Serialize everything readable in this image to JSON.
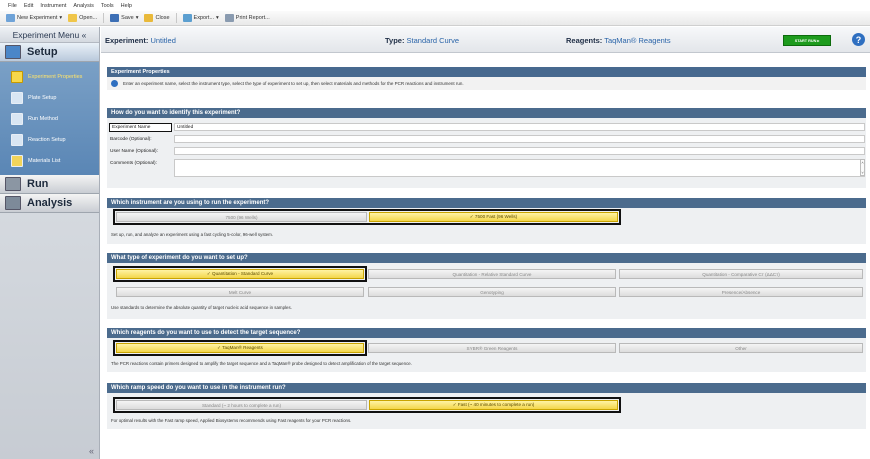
{
  "menubar": [
    "File",
    "Edit",
    "Instrument",
    "Analysis",
    "Tools",
    "Help"
  ],
  "toolbar": {
    "new_experiment": "New Experiment",
    "open": "Open...",
    "save": "Save",
    "close": "Close",
    "export": "Export...",
    "print_report": "Print Report..."
  },
  "sidebar": {
    "title": "Experiment Menu «",
    "setup": "Setup",
    "items": [
      "Experiment Properties",
      "Plate Setup",
      "Run Method",
      "Reaction Setup",
      "Materials List"
    ],
    "run": "Run",
    "analysis": "Analysis",
    "collapse": "«"
  },
  "header": {
    "experiment_label": "Experiment:",
    "experiment_value": "Untitled",
    "type_label": "Type:",
    "type_value": "Standard Curve",
    "reagents_label": "Reagents:",
    "reagents_value": "TaqMan® Reagents",
    "start_run": "START RUN ▸",
    "help": "?"
  },
  "properties": {
    "title": "Experiment Properties",
    "info": "Enter an experiment name, select the instrument type, select the type of experiment to set up, then select materials and methods for the PCR reactions and instrument run."
  },
  "identify": {
    "question": "How do you want to identify this experiment?",
    "name_label": "Experiment Name",
    "name_value": "Untitled",
    "barcode_label": "Barcode (Optional):",
    "username_label": "User Name (Optional):",
    "comments_label": "Comments (Optional):"
  },
  "instrument": {
    "question": "Which instrument are you using to run the experiment?",
    "opt1": "7500 (96 Wells)",
    "opt2": "✓ 7500 Fast (96 Wells)",
    "desc": "Set up, run, and analyze an experiment using a fast cycling 5-color, 96-well system."
  },
  "exptype": {
    "question": "What type of experiment do you want to set up?",
    "opt1": "✓ Quantitation - Standard Curve",
    "opt2": "Quantitation - Relative Standard Curve",
    "opt3": "Quantitation - Comparative Cт (ΔΔCт)",
    "opt4": "Melt Curve",
    "opt5": "Genotyping",
    "opt6": "Presence/Absence",
    "desc": "Use standards to determine the absolute quantity of target nucleic acid sequence in samples."
  },
  "reagents": {
    "question": "Which reagents do you want to use to detect the target sequence?",
    "opt1": "✓ TaqMan® Reagents",
    "opt2": "SYBR® Green Reagents",
    "opt3": "Other",
    "desc": "The PCR reactions contain primers designed to amplify the target sequence and a TaqMan® probe designed to detect amplification of the target sequence."
  },
  "ramp": {
    "question": "Which ramp speed do you want to use in the instrument run?",
    "opt1": "Standard (~ 2 hours to complete a run)",
    "opt2": "✓ Fast (~ 40 minutes to complete a run)",
    "desc": "For optimal results with the Fast ramp speed, Applied Biosystems recommends using Fast reagents for your PCR reactions."
  }
}
